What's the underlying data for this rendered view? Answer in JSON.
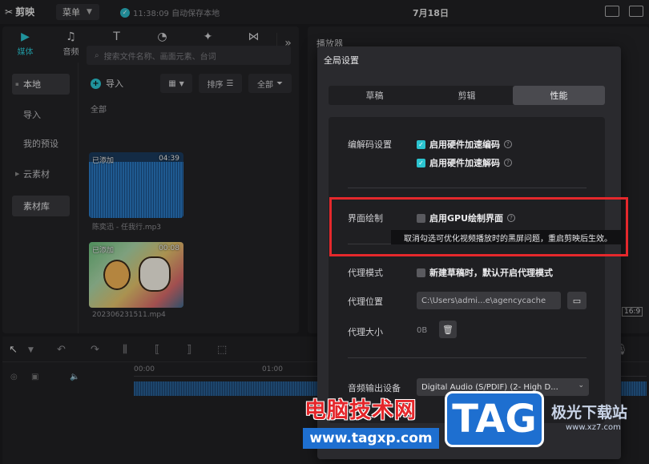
{
  "app": {
    "logo_text": "剪映",
    "menu_label": "菜单",
    "save_status": "11:38:09 自动保存本地",
    "date": "7月18日"
  },
  "media_panel": {
    "tabs": [
      {
        "label": "媒体",
        "icon": "media-icon"
      },
      {
        "label": "音频",
        "icon": "audio-icon"
      },
      {
        "label": "文本",
        "icon": "text-icon"
      },
      {
        "label": "贴纸",
        "icon": "sticker-icon"
      },
      {
        "label": "特效",
        "icon": "effects-icon"
      },
      {
        "label": "转场",
        "icon": "transition-icon"
      }
    ],
    "nav": [
      {
        "label": "本地"
      },
      {
        "label": "导入"
      },
      {
        "label": "我的预设"
      },
      {
        "label": "云素材"
      },
      {
        "label": "素材库"
      }
    ],
    "search_placeholder": "搜索文件名称、画面元素、台词",
    "import_label": "导入",
    "sort_label": "排序",
    "filter_label": "全部",
    "section_all": "全部",
    "items": [
      {
        "added": "已添加",
        "duration": "04:39",
        "name": "陈奕迅 - 任我行.mp3"
      },
      {
        "added": "已添加",
        "duration": "00:08",
        "name": "202306231511.mp4"
      }
    ]
  },
  "player": {
    "title": "播放器",
    "ratio": "16:9"
  },
  "timeline": {
    "ruler": [
      "00:00",
      "01:00"
    ]
  },
  "dialog": {
    "title": "全局设置",
    "tabs": [
      {
        "label": "草稿",
        "active": false
      },
      {
        "label": "剪辑",
        "active": false
      },
      {
        "label": "性能",
        "active": true
      }
    ],
    "codec": {
      "label": "编解码设置",
      "hw_encode": "启用硬件加速编码",
      "hw_decode": "启用硬件加速解码"
    },
    "render": {
      "label": "界面绘制",
      "gpu": "启用GPU绘制界面",
      "tooltip": "取消勾选可优化视频播放时的黑屏问题，重启剪映后生效。"
    },
    "proxy": {
      "mode_label": "代理模式",
      "mode_option": "新建草稿时，默认开启代理模式",
      "location_label": "代理位置",
      "location_value": "C:\\Users\\admi...e\\agencycache",
      "size_label": "代理大小",
      "size_value": "0B"
    },
    "audio": {
      "label": "音频输出设备",
      "value": "Digital Audio (S/PDIF) (2- High D..."
    }
  },
  "watermark": {
    "cn_text": "电脑技术网",
    "url": "www.tagxp.com",
    "tag": "TAG",
    "site": "极光下载站",
    "site_url": "www.xz7.com"
  },
  "colors": {
    "accent": "#2bc4d0",
    "highlight_box": "#e5282c"
  }
}
